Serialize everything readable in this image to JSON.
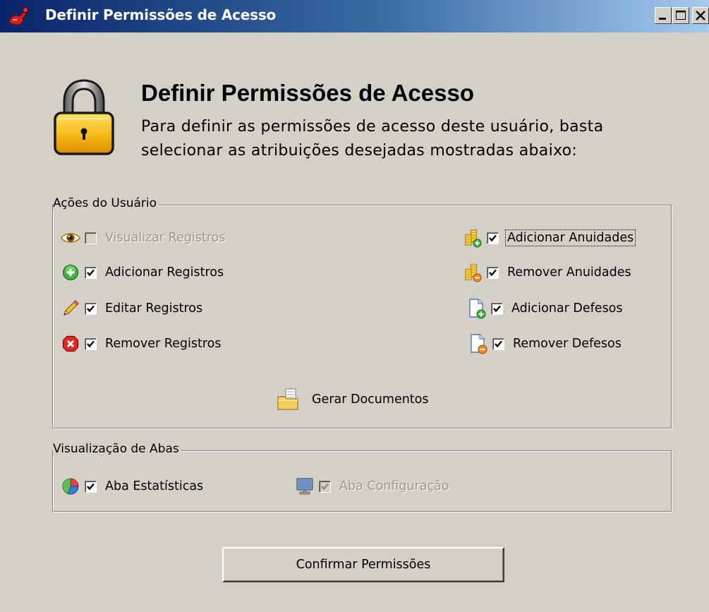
{
  "window": {
    "title": "Definir Permissões de Acesso",
    "icon": "app-icon",
    "controls": [
      "minimize",
      "maximize",
      "close"
    ]
  },
  "header": {
    "icon": "lock-icon",
    "title": "Definir Permissões de Acesso",
    "description_line1": "Para definir as permissões de acesso deste usuário, basta",
    "description_line2": "selecionar as atribuições desejadas mostradas abaixo:"
  },
  "user_actions": {
    "legend": "Ações do Usuário",
    "left": [
      {
        "label": "Visualizar Registros",
        "icon": "eye-icon",
        "checked": false,
        "enabled": false
      },
      {
        "label": "Adicionar Registros",
        "icon": "add-icon",
        "checked": true,
        "enabled": true
      },
      {
        "label": "Editar Registros",
        "icon": "pencil-icon",
        "checked": true,
        "enabled": true
      },
      {
        "label": "Remover Registros",
        "icon": "remove-icon",
        "checked": true,
        "enabled": true
      }
    ],
    "right": [
      {
        "label": "Adicionar Anuidades",
        "icon": "coins-add-icon",
        "checked": true,
        "enabled": true,
        "focused": true
      },
      {
        "label": "Remover Anuidades",
        "icon": "coins-remove-icon",
        "checked": true,
        "enabled": true
      },
      {
        "label": "Adicionar Defesos",
        "icon": "document-add-icon",
        "checked": true,
        "enabled": true
      },
      {
        "label": "Remover Defesos",
        "icon": "document-remove-icon",
        "checked": true,
        "enabled": true
      }
    ],
    "generate_docs": {
      "label": "Gerar Documentos",
      "icon": "documents-folder-icon"
    }
  },
  "tabs_view": {
    "legend": "Visualização de Abas",
    "items": [
      {
        "label": "Aba Estatísticas",
        "icon": "pie-chart-icon",
        "checked": true,
        "enabled": true
      },
      {
        "label": "Aba Configuração",
        "icon": "monitor-icon",
        "checked": true,
        "enabled": false
      }
    ]
  },
  "confirm_button": {
    "label": "Confirmar Permissões"
  },
  "colors": {
    "titlebar_start": "#0a246a",
    "titlebar_end": "#a6caf0",
    "window_bg": "#d4d0c8",
    "disabled_text": "#9a978f"
  }
}
